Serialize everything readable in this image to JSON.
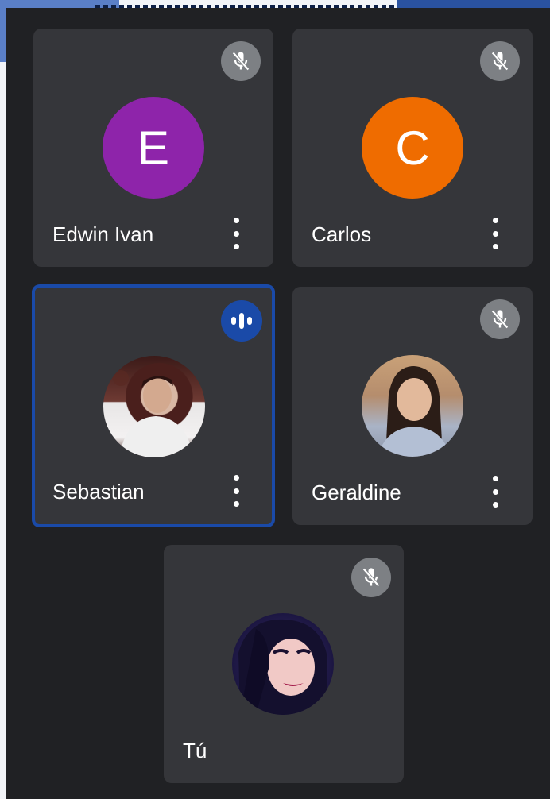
{
  "participants": [
    {
      "name": "Edwin Ivan",
      "initial": "E",
      "avatar_color": "#8e24aa",
      "muted": true
    },
    {
      "name": "Carlos",
      "initial": "C",
      "avatar_color": "#ef6c00",
      "muted": true
    },
    {
      "name": "Sebastian",
      "avatar_color": "#5b2a26",
      "muted": false,
      "speaking": true
    },
    {
      "name": "Geraldine",
      "avatar_color": "#b89a85",
      "muted": true
    },
    {
      "name": "Tú",
      "avatar_color": "#3d2a52",
      "muted": true
    }
  ],
  "icons": {
    "mute": "mic-off-icon",
    "speaking": "audio-wave-icon",
    "more": "more-vert-icon"
  },
  "colors": {
    "background": "#202124",
    "tile": "#35363a",
    "speaking_border": "#1a4aa8",
    "mute_badge": "#7d8084"
  }
}
